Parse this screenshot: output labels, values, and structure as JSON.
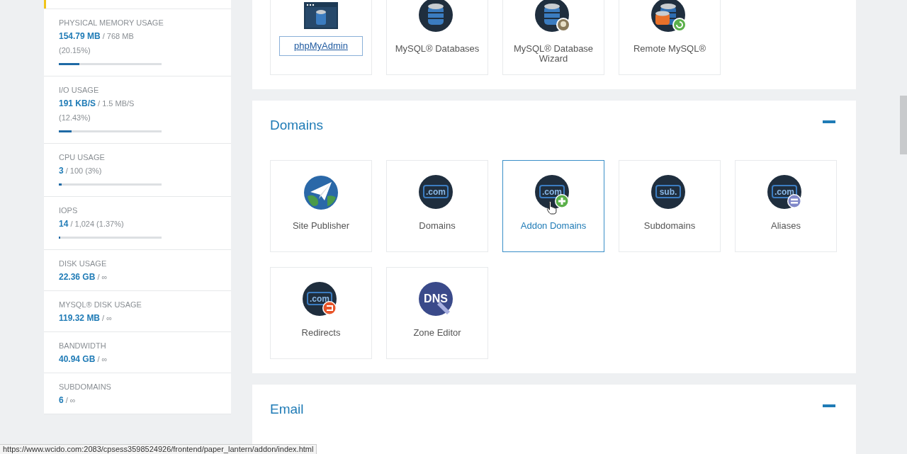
{
  "sidebar": {
    "stats": [
      {
        "label": "PHYSICAL MEMORY USAGE",
        "value": "154.79 MB",
        "limit": "/ 768 MB",
        "percent": "(20.15%)",
        "level": 0.2015
      },
      {
        "label": "I/O USAGE",
        "value": "191 KB/S",
        "limit": "/ 1.5 MB/S",
        "percent": "(12.43%)",
        "level": 0.1243
      },
      {
        "label": "CPU USAGE",
        "value": "3",
        "limit": "/ 100 (3%)",
        "level": 0.03
      },
      {
        "label": "IOPS",
        "value": "14",
        "limit": "/ 1,024 (1.37%)",
        "level": 0.0137
      },
      {
        "label": "DISK USAGE",
        "value": "22.36 GB",
        "limit": "/ ∞"
      },
      {
        "label": "MYSQL® DISK USAGE",
        "value": "119.32 MB",
        "limit": "/ ∞"
      },
      {
        "label": "BANDWIDTH",
        "value": "40.94 GB",
        "limit": "/ ∞"
      },
      {
        "label": "SUBDOMAINS",
        "value": "6",
        "limit": "/ ∞"
      }
    ]
  },
  "sections": [
    {
      "items": [
        {
          "label": "phpMyAdmin",
          "kind": "phpmyadmin",
          "focused": true,
          "selected": false
        },
        {
          "label": "MySQL® Databases",
          "kind": "database",
          "focused": false,
          "selected": false
        },
        {
          "label": "MySQL® Database Wizard",
          "kind": "database-wizard",
          "focused": false,
          "selected": false
        },
        {
          "label": "Remote MySQL®",
          "kind": "database-remote",
          "focused": false,
          "selected": false
        }
      ]
    },
    {
      "title": "Domains",
      "expanded": true,
      "items": [
        {
          "label": "Site Publisher",
          "kind": "publisher",
          "focused": false,
          "selected": false
        },
        {
          "label": "Domains",
          "kind": "domain",
          "badge": ".com",
          "focused": false,
          "selected": false
        },
        {
          "label": "Addon Domains",
          "kind": "domain-add",
          "badge": ".com",
          "focused": false,
          "selected": true
        },
        {
          "label": "Subdomains",
          "kind": "domain",
          "badge": "sub.",
          "focused": false,
          "selected": false
        },
        {
          "label": "Aliases",
          "kind": "domain-alias",
          "badge": ".com",
          "focused": false,
          "selected": false
        },
        {
          "label": "Redirects",
          "kind": "domain-redirect",
          "badge": ".com",
          "focused": false,
          "selected": false
        },
        {
          "label": "Zone Editor",
          "kind": "dns",
          "badge": "DNS",
          "focused": false,
          "selected": false
        }
      ]
    },
    {
      "title": "Email",
      "expanded": true
    }
  ],
  "status_bar": {
    "url": "https://www.wcido.com:2083/cpsess3598524926/frontend/paper_lantern/addon/index.html"
  }
}
